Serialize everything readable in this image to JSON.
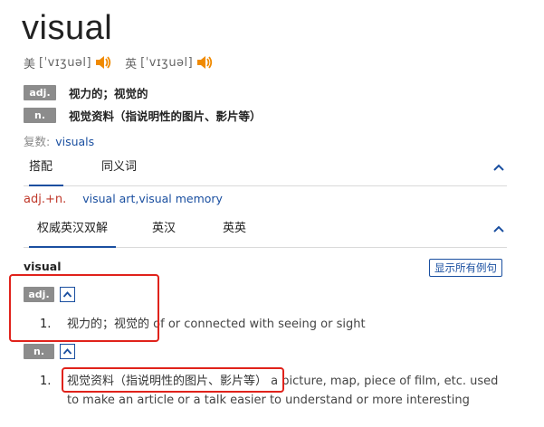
{
  "headword": "visual",
  "phonetics": [
    {
      "label": "美",
      "ipa": "[ˈvɪʒuəl]"
    },
    {
      "label": "英",
      "ipa": "[ˈvɪʒuəl]"
    }
  ],
  "senses_summary": [
    {
      "pos": "adj.",
      "text": "视力的；视觉的"
    },
    {
      "pos": "n.",
      "text": "视觉资料（指说明性的图片、影片等）"
    }
  ],
  "plural": {
    "label": "复数:",
    "value": "visuals"
  },
  "collocation_tabs": [
    {
      "label": "搭配",
      "active": true
    },
    {
      "label": "同义词",
      "active": false
    }
  ],
  "collocation": {
    "label": "adj.+n.",
    "value": "visual art,visual memory"
  },
  "dict_tabs": [
    {
      "label": "权威英汉双解",
      "active": true
    },
    {
      "label": "英汉",
      "active": false
    },
    {
      "label": "英英",
      "active": false
    }
  ],
  "entry": {
    "word": "visual",
    "show_examples": "显示所有例句",
    "adj": {
      "pos": "adj.",
      "num": "1.",
      "cn": "视力的；视觉的",
      "en": "of or connected with seeing or sight"
    },
    "noun": {
      "pos": "n.",
      "num": "1.",
      "cn": "视觉资料（指说明性的图片、影片等）",
      "en_line1": "a picture, map, piece of film, etc. used",
      "en_line2": "to make an article or a talk easier to understand or more interesting"
    }
  },
  "colors": {
    "accent": "#1a4fa0",
    "speaker": "#f08a00",
    "highlight_box": "#e0221b",
    "tag_bg": "#8c8c8c"
  }
}
